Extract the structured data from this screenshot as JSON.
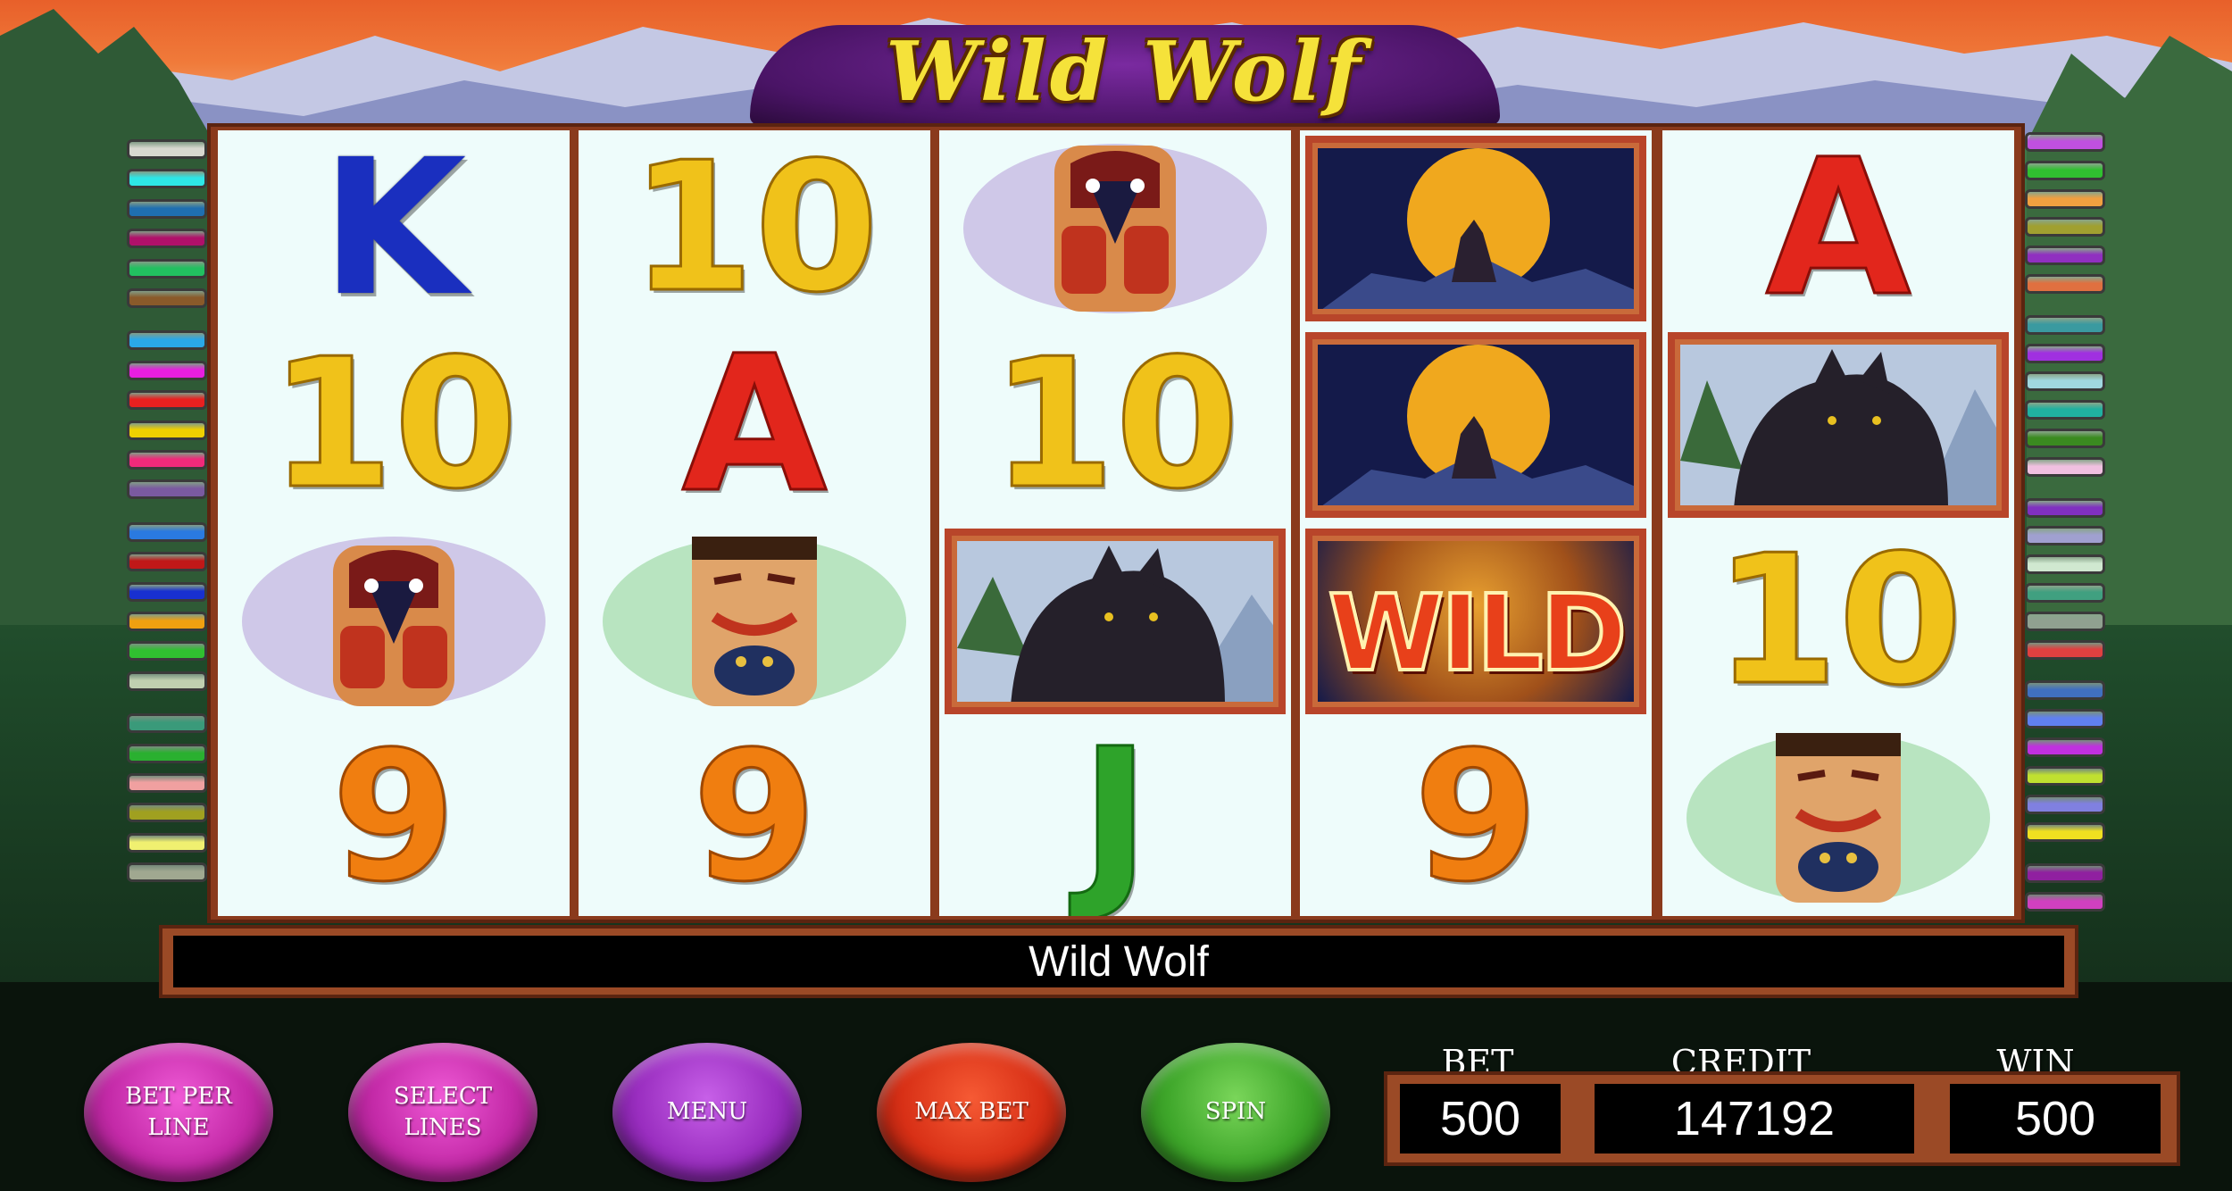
{
  "game": {
    "title": "Wild Wolf",
    "message": "Wild Wolf"
  },
  "reels": [
    [
      "K",
      "10",
      "raven-totem",
      "9"
    ],
    [
      "10",
      "A",
      "frog-totem",
      "9"
    ],
    [
      "raven-totem",
      "10",
      "black-wolf",
      "J"
    ],
    [
      "howling-wolf-moon",
      "howling-wolf-moon",
      "wild",
      "9"
    ],
    [
      "A",
      "black-wolf",
      "10",
      "frog-totem"
    ]
  ],
  "wild_label": "WILD",
  "buttons": {
    "bet_per_line": "BET PER LINE",
    "select_lines": "SELECT LINES",
    "menu": "MENU",
    "max_bet": "MAX BET",
    "spin": "SPIN"
  },
  "meters": {
    "bet_label": "BET",
    "bet_value": "500",
    "credit_label": "CREDIT",
    "credit_value": "147192",
    "win_label": "WIN",
    "win_value": "500"
  },
  "payline_colors": {
    "left": [
      "#d8d8d0",
      "#2ee6e6",
      "#1f6fb0",
      "#b0106a",
      "#22c060",
      "#8a5a2a",
      "#2aa8e8",
      "#e81ee0",
      "#e82020",
      "#f0d000",
      "#f02a7a",
      "#7a5aa0",
      "#2a7ae0",
      "#c01818",
      "#1830d0",
      "#f0a010",
      "#30c030",
      "#c0d0b0",
      "#3a9a7a",
      "#2ab030",
      "#f0a0a0",
      "#a0a020",
      "#f0f070",
      "#a0a890"
    ],
    "right": [
      "#c050e0",
      "#30c030",
      "#f0a040",
      "#a0a030",
      "#9030c0",
      "#e07040",
      "#3a9aa0",
      "#a030e0",
      "#a0d8e0",
      "#20b0a0",
      "#3a8a20",
      "#f0c0e0",
      "#8030c0",
      "#a0a0d0",
      "#d0e8d0",
      "#40a080",
      "#90a090",
      "#e04040",
      "#4070c0",
      "#6080f0",
      "#c030e0",
      "#c0e030",
      "#8080e0",
      "#f0e020",
      "#9020a0",
      "#d040c0"
    ]
  }
}
